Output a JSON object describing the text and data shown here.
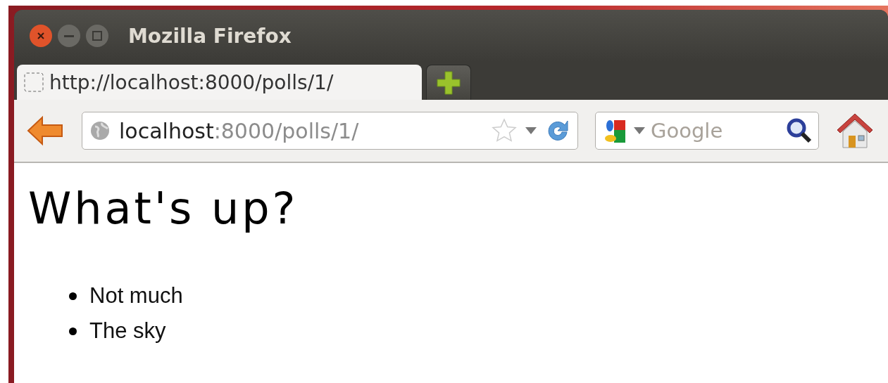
{
  "window": {
    "title": "Mozilla Firefox"
  },
  "tabs": [
    {
      "title": "http://localhost:8000/polls/1/",
      "selected": true
    }
  ],
  "address_bar": {
    "host": "localhost",
    "path": ":8000/polls/1/"
  },
  "search": {
    "placeholder": "Google"
  },
  "page": {
    "heading": "What's up?",
    "items": [
      "Not much",
      "The sky"
    ]
  }
}
